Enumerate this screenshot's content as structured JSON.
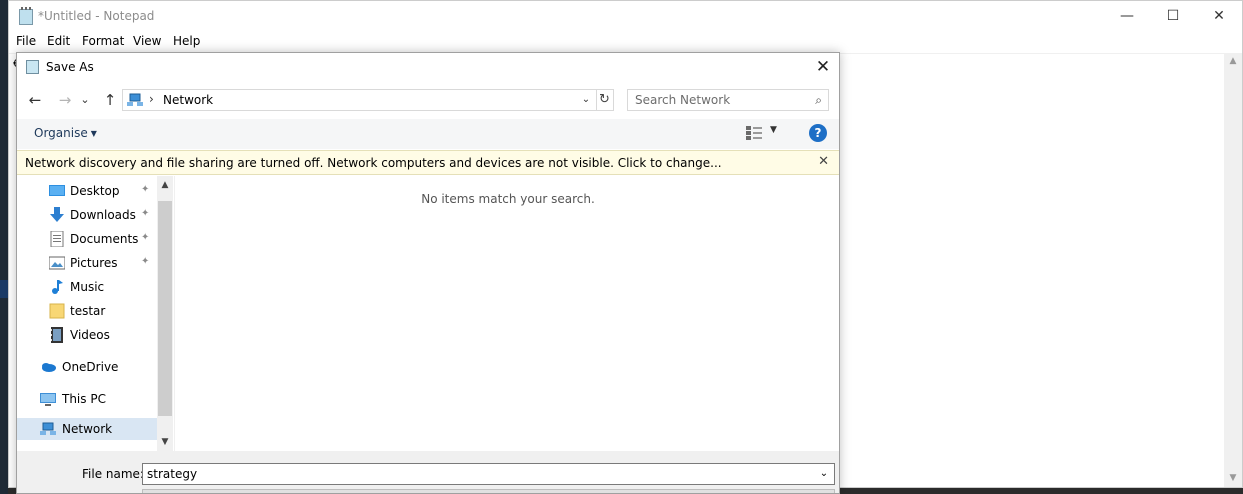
{
  "notepad": {
    "title": "*Untitled - Notepad",
    "menu": [
      "File",
      "Edit",
      "Format",
      "View",
      "Help"
    ],
    "caption": {
      "minimize": "—",
      "maximize": "☐",
      "close": "✕"
    },
    "text_fragment": "€"
  },
  "dialog": {
    "title": "Save As",
    "close_glyph": "✕",
    "nav": {
      "back": "←",
      "forward": "→",
      "recent": "⌄",
      "up": "↑"
    },
    "address": {
      "separator": "›",
      "location": "Network",
      "dropdown": "⌄"
    },
    "refresh_glyph": "↻",
    "search": {
      "placeholder": "Search Network",
      "icon": "search-icon"
    },
    "toolbar": {
      "organise": "Organise",
      "caret": "▼",
      "views_caret": "▼",
      "help": "?"
    },
    "infobar": {
      "message": "Network discovery and file sharing are turned off. Network computers and devices are not visible. Click to change...",
      "close": "✕"
    },
    "sidebar": {
      "quick_access": [
        {
          "label": "Desktop",
          "icon": "desktop-icon",
          "pinned": true
        },
        {
          "label": "Downloads",
          "icon": "downloads-icon",
          "pinned": true
        },
        {
          "label": "Documents",
          "icon": "documents-icon",
          "pinned": true
        },
        {
          "label": "Pictures",
          "icon": "pictures-icon",
          "pinned": true
        },
        {
          "label": "Music",
          "icon": "music-icon",
          "pinned": false
        },
        {
          "label": "testar",
          "icon": "folder-icon",
          "pinned": false
        },
        {
          "label": "Videos",
          "icon": "videos-icon",
          "pinned": false
        }
      ],
      "onedrive": "OneDrive",
      "this_pc": "This PC",
      "network": "Network",
      "pin_glyph": "📌"
    },
    "content": {
      "empty_message": "No items match your search."
    },
    "bottom": {
      "file_name_label": "File name:",
      "file_name_value": "strategy",
      "dropdown": "⌄"
    }
  },
  "colors": {
    "accent": "#1e6fc6",
    "infobar": "#fffce6",
    "selection": "#d9e6f3"
  }
}
